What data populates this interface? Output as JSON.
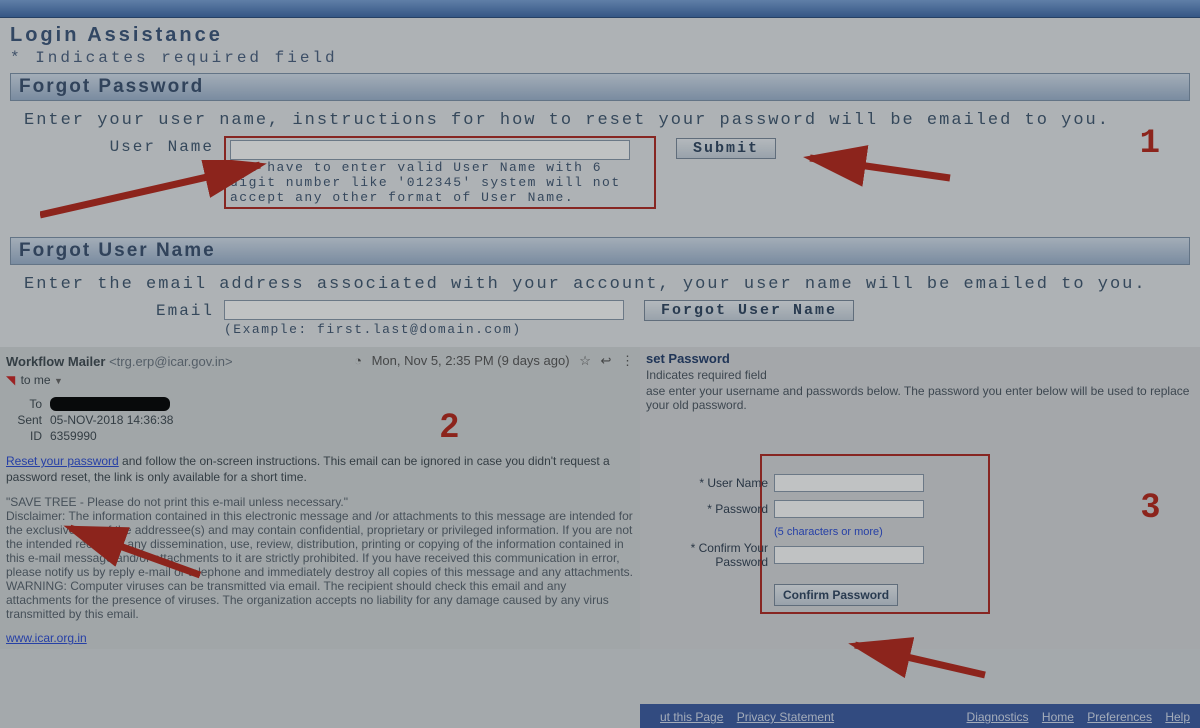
{
  "header": {
    "title": "Login Assistance",
    "required_note": "*  Indicates required field"
  },
  "forgot_password": {
    "heading": "Forgot Password",
    "instruction": "Enter your user name, instructions for how to reset your password will be emailed to you.",
    "username_label": "User Name",
    "hint": "You have to enter valid User Name with 6 digit number like '012345' system will not accept any other format of User Name.",
    "submit_label": "Submit"
  },
  "forgot_username": {
    "heading": "Forgot User Name",
    "instruction": "Enter the email address associated with your account, your user name will be emailed to you.",
    "email_label": "Email",
    "example": "(Example: first.last@domain.com)",
    "button_label": "Forgot User Name"
  },
  "steps": {
    "one": "1",
    "two": "2",
    "three": "3"
  },
  "email": {
    "from_name": "Workflow Mailer",
    "from_addr": "<trg.erp@icar.gov.in>",
    "date_display": "Mon, Nov 5, 2:35 PM (9 days ago)",
    "to_me": "to me",
    "to_label": "To",
    "sent_label": "Sent",
    "sent_value": "05-NOV-2018 14:36:38",
    "id_label": "ID",
    "id_value": "6359990",
    "reset_link_text": "Reset your password",
    "body_after_link": " and follow the on-screen instructions. This email can be ignored in case you didn't request a password reset, the link is only available for a short time.",
    "save_tree": "\"SAVE TREE - Please do not print this e-mail unless necessary.\"",
    "disclaimer": "Disclaimer: The information contained in this electronic message and /or attachments to this message are intended for the exclusive use of the addressee(s) and may contain confidential, proprietary or privileged information. If you are not the intended recipient, any dissemination, use, review, distribution, printing or copying of the information contained in this e-mail message and/or attachments to it are strictly prohibited. If you have received this communication in error, please notify us by reply e-mail or telephone and immediately destroy all copies of this message and any attachments. WARNING: Computer viruses can be transmitted via email. The recipient should check this email and any attachments for the presence of viruses. The organization accepts no liability for any damage caused by any virus transmitted by this email.",
    "site_link": "www.icar.org.in"
  },
  "reset_panel": {
    "title": "set Password",
    "required": "Indicates required field",
    "instruction": "ase enter your username and passwords below. The password you enter below will be used to replace your old password.",
    "username_label": "* User Name",
    "password_label": "* Password",
    "password_hint": "(5 characters or more)",
    "confirm_label": "* Confirm Your Password",
    "confirm_button": "Confirm Password"
  },
  "footer": {
    "left1": "ut this Page",
    "left2": "Privacy Statement",
    "diagnostics": "Diagnostics",
    "home": "Home",
    "preferences": "Preferences",
    "help": "Help"
  },
  "icons": {
    "eye": "◔",
    "star": "☆",
    "reply": "↩",
    "more": "⋮",
    "dropdown": "▼"
  }
}
